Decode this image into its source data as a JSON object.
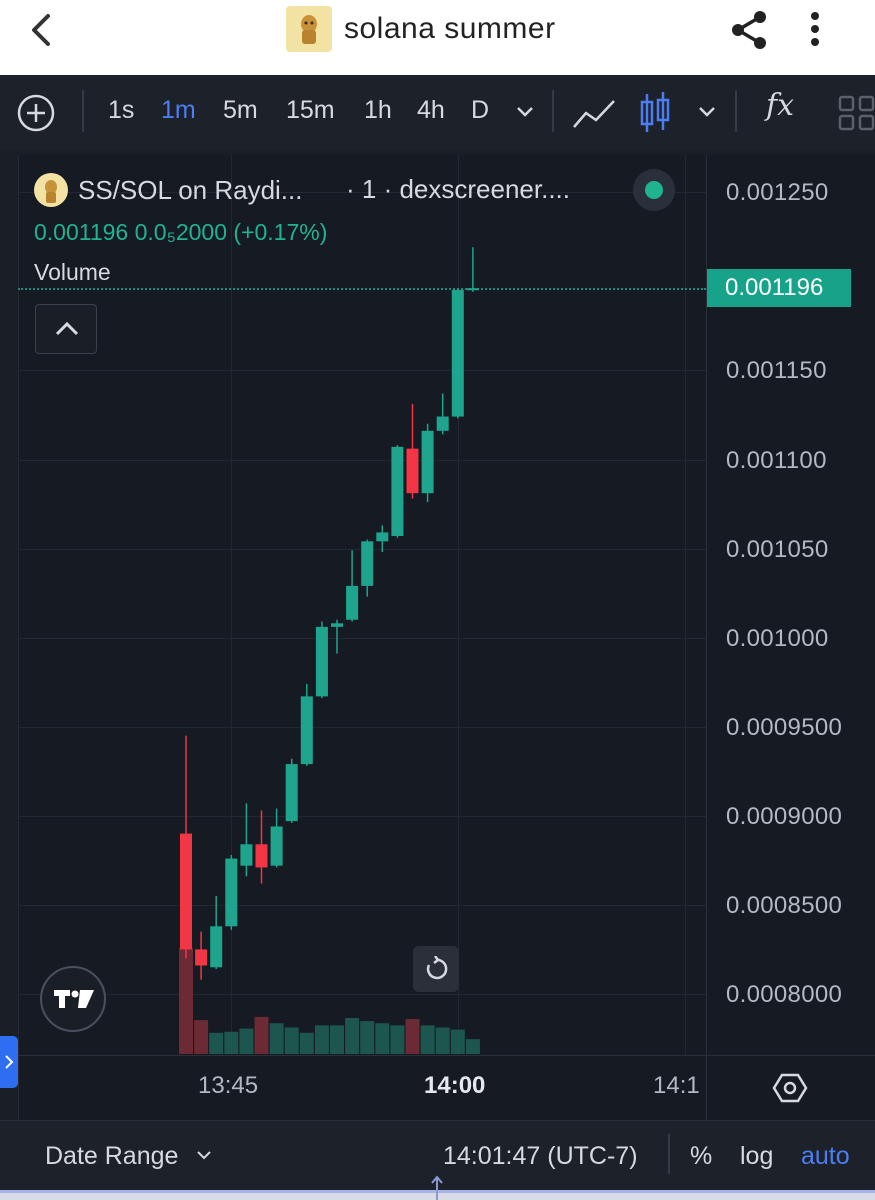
{
  "app_bar": {
    "title": "solana summer",
    "icons": [
      "back-icon",
      "token-thumbnail",
      "share-icon",
      "more-vert-icon"
    ]
  },
  "toolbar": {
    "add_icon": "plus-circle-icon",
    "intervals": [
      "1s",
      "1m",
      "5m",
      "15m",
      "1h",
      "4h",
      "D"
    ],
    "active_interval": "1m",
    "chart_type_icons": [
      "line-chart-icon",
      "candles-icon"
    ],
    "fx_label": "fx"
  },
  "legend": {
    "symbol": "SS/SOL on Raydi...",
    "meta": "· 1 · dexscreener....",
    "ohlc_text": "0.001196  0.0₅2000 (+0.17%)",
    "volume_label": "Volume",
    "status_color": "#1fb48f"
  },
  "price_axis": {
    "labels": [
      "0.001250",
      "0.001150",
      "0.001100",
      "0.001050",
      "0.001000",
      "0.0009500",
      "0.0009000",
      "0.0008500",
      "0.0008000"
    ],
    "current_price": "0.001196"
  },
  "time_axis": {
    "labels": [
      "13:45",
      "14:00",
      "14:1"
    ],
    "bold_label": "14:00"
  },
  "bottom_bar": {
    "date_range": "Date Range",
    "time": "14:01:47 (UTC-7)",
    "percent": "%",
    "log": "log",
    "auto": "auto"
  },
  "colors": {
    "up": "#1fa58e",
    "down": "#f23645",
    "accent": "#4c7df2",
    "background": "#161a22"
  },
  "chart_data": {
    "type": "candlestick",
    "interval": "1m",
    "ylim": [
      0.00077,
      0.00127
    ],
    "candles": [
      {
        "time": "13:44",
        "open": 0.00089,
        "high": 0.000945,
        "low": 0.00082,
        "close": 0.000825
      },
      {
        "time": "13:45",
        "open": 0.000825,
        "high": 0.000835,
        "low": 0.000808,
        "close": 0.000816
      },
      {
        "time": "13:46",
        "open": 0.000815,
        "high": 0.000855,
        "low": 0.000814,
        "close": 0.000838
      },
      {
        "time": "13:47",
        "open": 0.000838,
        "high": 0.000878,
        "low": 0.000836,
        "close": 0.000876
      },
      {
        "time": "13:48",
        "open": 0.000872,
        "high": 0.000907,
        "low": 0.000866,
        "close": 0.000884
      },
      {
        "time": "13:49",
        "open": 0.000884,
        "high": 0.000903,
        "low": 0.000862,
        "close": 0.000871
      },
      {
        "time": "13:50",
        "open": 0.000872,
        "high": 0.000904,
        "low": 0.000871,
        "close": 0.000894
      },
      {
        "time": "13:51",
        "open": 0.000897,
        "high": 0.000932,
        "low": 0.000896,
        "close": 0.000929
      },
      {
        "time": "13:52",
        "open": 0.000929,
        "high": 0.000974,
        "low": 0.000928,
        "close": 0.000967
      },
      {
        "time": "13:53",
        "open": 0.000967,
        "high": 0.001009,
        "low": 0.000966,
        "close": 0.001006
      },
      {
        "time": "13:54",
        "open": 0.001006,
        "high": 0.00101,
        "low": 0.000991,
        "close": 0.001008
      },
      {
        "time": "13:55",
        "open": 0.00101,
        "high": 0.001049,
        "low": 0.001009,
        "close": 0.001029
      },
      {
        "time": "13:56",
        "open": 0.001029,
        "high": 0.001055,
        "low": 0.001023,
        "close": 0.001054
      },
      {
        "time": "13:57",
        "open": 0.001054,
        "high": 0.001063,
        "low": 0.001048,
        "close": 0.001059
      },
      {
        "time": "13:58",
        "open": 0.001057,
        "high": 0.001108,
        "low": 0.001056,
        "close": 0.001107
      },
      {
        "time": "13:59",
        "open": 0.001106,
        "high": 0.001131,
        "low": 0.001078,
        "close": 0.001081
      },
      {
        "time": "14:00",
        "open": 0.001081,
        "high": 0.00112,
        "low": 0.001076,
        "close": 0.001116
      },
      {
        "time": "14:01",
        "open": 0.001116,
        "high": 0.001137,
        "low": 0.001114,
        "close": 0.001124
      },
      {
        "time": "14:02",
        "open": 0.001124,
        "high": 0.001196,
        "low": 0.001123,
        "close": 0.001195
      },
      {
        "time": "14:03",
        "open": 0.001195,
        "high": 0.001219,
        "low": 0.001194,
        "close": 0.001196
      }
    ],
    "volume_relative": [
      1.0,
      0.32,
      0.2,
      0.21,
      0.24,
      0.35,
      0.29,
      0.25,
      0.2,
      0.27,
      0.27,
      0.34,
      0.31,
      0.29,
      0.27,
      0.33,
      0.27,
      0.25,
      0.23,
      0.14
    ],
    "price_ticks": [
      0.00125,
      0.00115,
      0.0011,
      0.00105,
      0.001,
      0.00095,
      0.0009,
      0.00085,
      0.0008
    ],
    "current_price": 0.001196
  }
}
